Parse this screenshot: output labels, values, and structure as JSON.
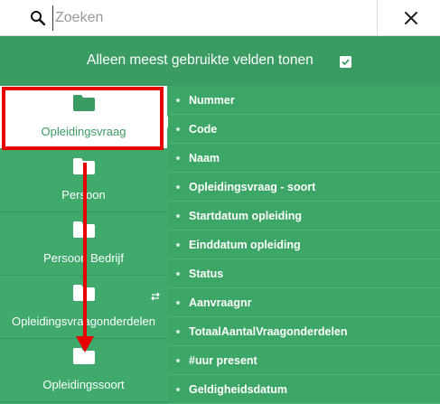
{
  "search": {
    "placeholder": "Zoeken",
    "value": ""
  },
  "header": {
    "label": "Alleen meest gebruikte velden tonen",
    "checked": true
  },
  "categories": [
    {
      "label": "Opleidingsvraag",
      "active": true
    },
    {
      "label": "Persoon"
    },
    {
      "label": "Persoon Bedrijf"
    },
    {
      "label": "Opleidingsvraagonderdelen"
    },
    {
      "label": "Opleidingssoort"
    }
  ],
  "fields": [
    "Nummer",
    "Code",
    "Naam",
    "Opleidingsvraag - soort",
    "Startdatum opleiding",
    "Einddatum opleiding",
    "Status",
    "Aanvraagnr",
    "TotaalAantalVraagonderdelen",
    "#uur present",
    "Geldigheidsdatum"
  ],
  "colors": {
    "accent_green": "#3faa6b",
    "header_green": "#3a9c63",
    "annotation_red": "#e60000"
  }
}
